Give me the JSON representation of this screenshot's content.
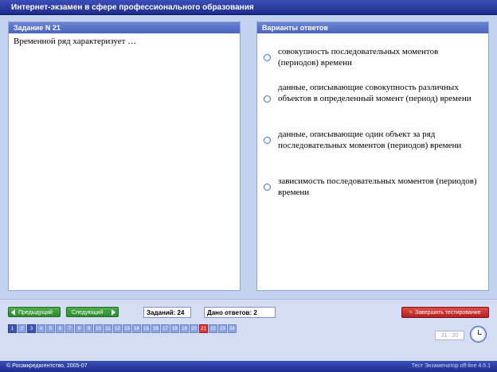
{
  "window": {
    "title": "Интернет-экзамен в сфере профессионального образования"
  },
  "task_panel": {
    "header": "Задание N 21",
    "question": "Временной ряд характеризует …"
  },
  "answers_panel": {
    "header": "Варианты ответов",
    "options": [
      {
        "text": "совокупность последовательных моментов (периодов) времени"
      },
      {
        "text": "данные, описывающие совокупность различных объектов в определенный момент (период) времени"
      },
      {
        "text": "данные, описывающие один объект за ряд последовательных моментов (периодов) времени"
      },
      {
        "text": "зависимость последовательных моментов (периодов) времени"
      }
    ]
  },
  "navigation": {
    "prev_label": "Предыдущий",
    "next_label": "Следующий",
    "tasks_count": "Заданий: 24",
    "answers_given": "Дано ответов: 2",
    "finish_label": "Завершить тестирование"
  },
  "question_numbers": [
    {
      "n": "1",
      "state": "answered"
    },
    {
      "n": "2",
      "state": "open"
    },
    {
      "n": "3",
      "state": "answered"
    },
    {
      "n": "4",
      "state": "open"
    },
    {
      "n": "5",
      "state": "open"
    },
    {
      "n": "6",
      "state": "open"
    },
    {
      "n": "7",
      "state": "open"
    },
    {
      "n": "8",
      "state": "open"
    },
    {
      "n": "9",
      "state": "open"
    },
    {
      "n": "10",
      "state": "open"
    },
    {
      "n": "11",
      "state": "open"
    },
    {
      "n": "12",
      "state": "open"
    },
    {
      "n": "13",
      "state": "open"
    },
    {
      "n": "14",
      "state": "open"
    },
    {
      "n": "15",
      "state": "open"
    },
    {
      "n": "16",
      "state": "open"
    },
    {
      "n": "17",
      "state": "open"
    },
    {
      "n": "18",
      "state": "open"
    },
    {
      "n": "19",
      "state": "open"
    },
    {
      "n": "20",
      "state": "open"
    },
    {
      "n": "21",
      "state": "current"
    },
    {
      "n": "22",
      "state": "open"
    },
    {
      "n": "23",
      "state": "open"
    },
    {
      "n": "24",
      "state": "open"
    }
  ],
  "timer": {
    "value": "31 : 20"
  },
  "status": {
    "left": "© Росаккредагентство, 2005-07",
    "right": "Тест Экзаменатор off-line 4.5.1"
  },
  "colors": {
    "title_bar": "#1e2d8c",
    "panel_header": "#4a63bd",
    "nav_button": "#2e8b2e",
    "finish_button": "#b52020",
    "current_question": "#d83a3a"
  }
}
